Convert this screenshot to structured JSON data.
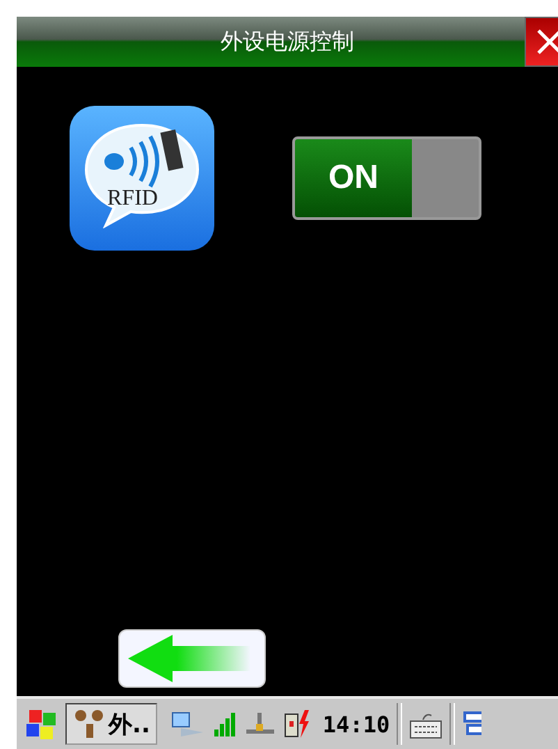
{
  "window": {
    "title": "外设电源控制"
  },
  "app_icon": {
    "label": "RFID"
  },
  "power_switch": {
    "label": "ON",
    "on": true
  },
  "taskbar": {
    "task": "外..",
    "clock": "14:10"
  }
}
